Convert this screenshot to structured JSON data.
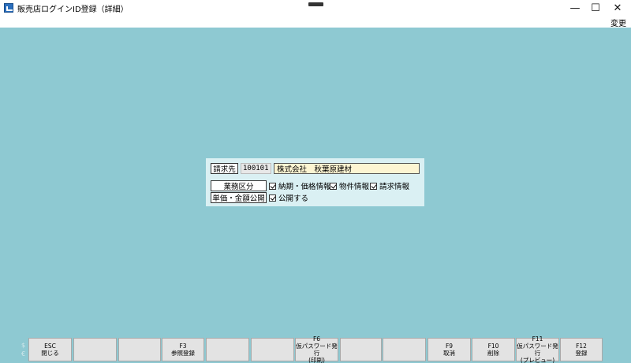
{
  "window": {
    "title": "販売店ログインID登録（詳細）",
    "minimize_glyph": "—",
    "maximize_glyph": "☐",
    "close_glyph": "✕"
  },
  "menu": {
    "change_label": "変更"
  },
  "form": {
    "billing_label": "請求先",
    "billing_code": "100101",
    "billing_name": "株式会社　秋葉原建材",
    "business_label": "業務区分",
    "business_options": [
      {
        "label": "納期・価格情報",
        "checked": true
      },
      {
        "label": "物件情報",
        "checked": true
      },
      {
        "label": "請求情報",
        "checked": true
      }
    ],
    "price_label": "単価・金額公開",
    "price_option": {
      "label": "公開する",
      "checked": true
    }
  },
  "side_marks": [
    "$",
    "€"
  ],
  "function_keys": [
    {
      "key": "ESC",
      "line1": "閉じる",
      "line2": ""
    },
    {
      "key": "",
      "line1": "",
      "line2": ""
    },
    {
      "key": "",
      "line1": "",
      "line2": ""
    },
    {
      "key": "F3",
      "line1": "参照登録",
      "line2": ""
    },
    {
      "key": "",
      "line1": "",
      "line2": ""
    },
    {
      "key": "",
      "line1": "",
      "line2": ""
    },
    {
      "key": "F6",
      "line1": "仮パスワード発行",
      "line2": "(印刷)"
    },
    {
      "key": "",
      "line1": "",
      "line2": ""
    },
    {
      "key": "",
      "line1": "",
      "line2": ""
    },
    {
      "key": "F9",
      "line1": "取消",
      "line2": ""
    },
    {
      "key": "F10",
      "line1": "削除",
      "line2": ""
    },
    {
      "key": "F11",
      "line1": "仮パスワード発行",
      "line2": "(プレビュー)"
    },
    {
      "key": "F12",
      "line1": "登録",
      "line2": ""
    }
  ],
  "colors": {
    "background": "#8ec9d2",
    "panel": "#daf0f3",
    "name_field": "#fdf5d2",
    "function_key": "#e3e3e3"
  }
}
